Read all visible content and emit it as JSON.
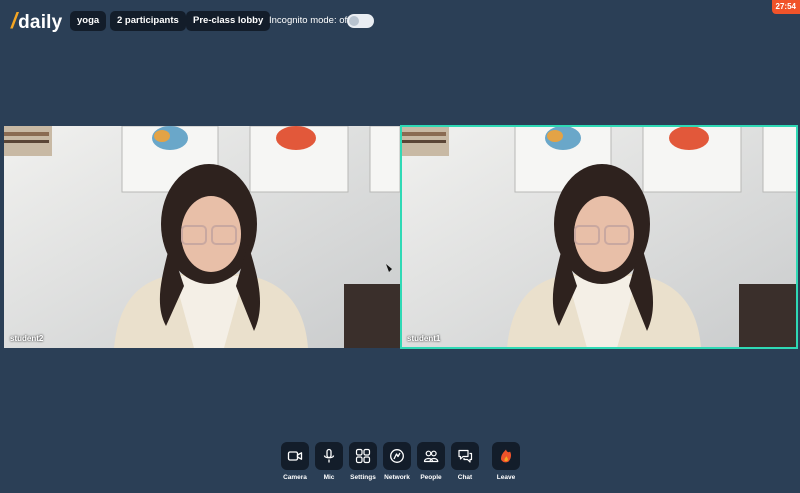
{
  "header": {
    "logo_slash": "/",
    "logo_text": "daily",
    "room_name": "yoga",
    "participants": "2 participants",
    "lobby": "Pre-class lobby",
    "incognito_label": "Incognito mode: off",
    "incognito_on": false,
    "timer": "27:54"
  },
  "tiles": [
    {
      "name": "student2",
      "active_speaker": false
    },
    {
      "name": "student1",
      "active_speaker": true,
      "highlight_color": "#2fd9b5"
    }
  ],
  "controls": [
    {
      "label": "Camera",
      "icon": "camera-icon"
    },
    {
      "label": "Mic",
      "icon": "mic-icon"
    },
    {
      "label": "Settings",
      "icon": "settings-icon"
    },
    {
      "label": "Network",
      "icon": "network-icon"
    },
    {
      "label": "People",
      "icon": "people-icon"
    },
    {
      "label": "Chat",
      "icon": "chat-icon"
    },
    {
      "label": "Leave",
      "icon": "leave-icon"
    }
  ],
  "colors": {
    "background": "#2b3f56",
    "pill": "#131d2a",
    "timer": "#f0532a",
    "leave_accent": "#f0532a"
  }
}
